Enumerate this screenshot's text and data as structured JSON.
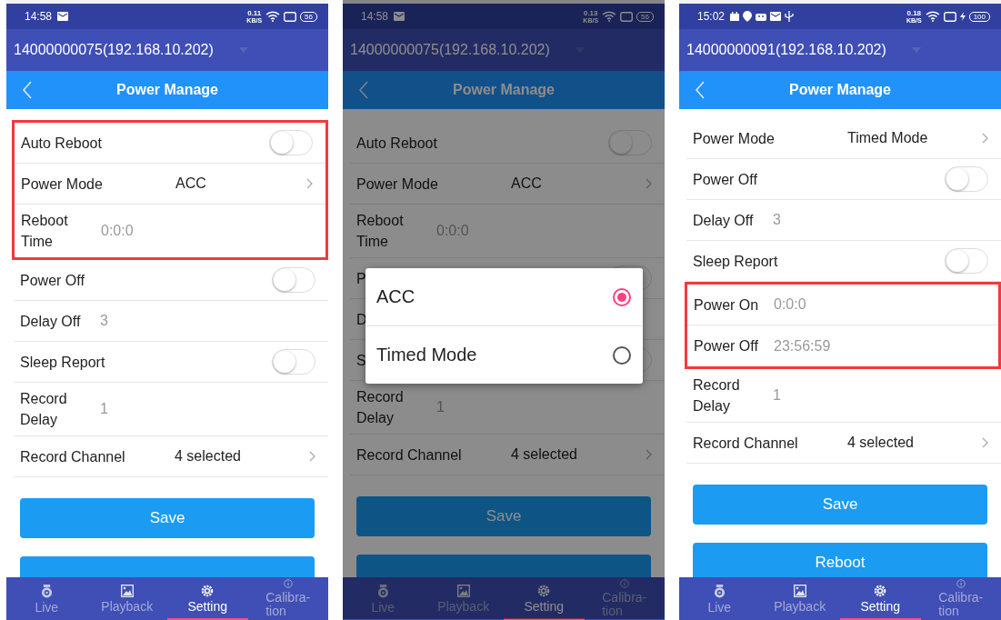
{
  "phones": [
    {
      "status": {
        "time": "14:58",
        "notifications": [
          {
            "kind": "mail"
          }
        ],
        "net_speed": "0.11",
        "net_unit": "KB/S",
        "battery": "56"
      },
      "device": "14000000075(192.168.10.202)",
      "title": "Power Manage",
      "at_top": true,
      "sections": [
        {
          "highlighted": true,
          "rows": [
            {
              "kind": "toggle",
              "label": "Auto Reboot",
              "on": false
            },
            {
              "kind": "select",
              "label": "Power Mode",
              "value": "ACC"
            },
            {
              "kind": "text",
              "label": "Reboot Time",
              "value": "0:0:0"
            }
          ]
        },
        {
          "highlighted": false,
          "rows": [
            {
              "kind": "toggle",
              "label": "Power Off",
              "on": false
            },
            {
              "kind": "text",
              "label": "Delay Off",
              "value": "3"
            },
            {
              "kind": "toggle",
              "label": "Sleep Report",
              "on": false
            },
            {
              "kind": "text",
              "label": "Record Delay",
              "value": "1"
            },
            {
              "kind": "select",
              "label": "Record Channel",
              "value": "4 selected"
            }
          ]
        }
      ],
      "buttons": [
        {
          "label": "Save"
        }
      ],
      "next_button_peek": true,
      "nav": [
        {
          "kind": "live",
          "label": "Live",
          "selected": false
        },
        {
          "kind": "playback",
          "label": "Playback",
          "selected": false
        },
        {
          "kind": "setting",
          "label": "Setting",
          "selected": true
        },
        {
          "kind": "calibration",
          "label": "Calibra-\ntion",
          "selected": false
        }
      ]
    },
    {
      "status": {
        "time": "14:58",
        "notifications": [
          {
            "kind": "mail"
          }
        ],
        "net_speed": "0.13",
        "net_unit": "KB/S",
        "battery": "56"
      },
      "device": "14000000075(192.168.10.202)",
      "title": "Power Manage",
      "at_top": true,
      "dimmed": true,
      "sections": [
        {
          "highlighted": false,
          "rows": [
            {
              "kind": "toggle",
              "label": "Auto Reboot",
              "on": false
            },
            {
              "kind": "select",
              "label": "Power Mode",
              "value": "ACC"
            },
            {
              "kind": "text",
              "label": "Reboot Time",
              "value": "0:0:0"
            },
            {
              "kind": "toggle",
              "label": "P",
              "on": false
            },
            {
              "kind": "text",
              "label": "D"
            },
            {
              "kind": "toggle",
              "label": "S",
              "on": false
            },
            {
              "kind": "text",
              "label": "Record Delay",
              "value": "1"
            },
            {
              "kind": "select",
              "label": "Record Channel",
              "value": "4 selected"
            }
          ]
        }
      ],
      "buttons": [
        {
          "label": "Save"
        }
      ],
      "next_button_peek": true,
      "dialog": {
        "options": [
          {
            "label": "ACC",
            "selected": true
          },
          {
            "label": "Timed Mode",
            "selected": false
          }
        ]
      },
      "nav": [
        {
          "kind": "live",
          "label": "Live",
          "selected": false
        },
        {
          "kind": "playback",
          "label": "Playback",
          "selected": false
        },
        {
          "kind": "setting",
          "label": "Setting",
          "selected": true
        },
        {
          "kind": "calibration",
          "label": "Calibra-\ntion",
          "selected": false
        }
      ]
    },
    {
      "status": {
        "time": "15:02",
        "notifications": [
          {
            "kind": "calendar"
          },
          {
            "kind": "location"
          },
          {
            "kind": "android"
          },
          {
            "kind": "mail"
          },
          {
            "kind": "usb"
          }
        ],
        "net_speed": "0.18",
        "net_unit": "KB/S",
        "charging": true,
        "battery": "100"
      },
      "device": "14000000091(192.168.10.202)",
      "title": "Power Manage",
      "at_top": false,
      "sections": [
        {
          "highlighted": false,
          "rows": [
            {
              "kind": "select",
              "label": "Power Mode",
              "value": "Timed Mode"
            },
            {
              "kind": "toggle",
              "label": "Power Off",
              "on": false
            },
            {
              "kind": "text",
              "label": "Delay Off",
              "value": "3"
            },
            {
              "kind": "toggle",
              "label": "Sleep Report",
              "on": false
            }
          ]
        },
        {
          "highlighted": true,
          "rows": [
            {
              "kind": "text",
              "label": "Power On",
              "value": "0:0:0"
            },
            {
              "kind": "text",
              "label": "Power Off",
              "value": "23:56:59"
            }
          ]
        },
        {
          "highlighted": false,
          "rows": [
            {
              "kind": "text",
              "label": "Record Delay",
              "value": "1"
            },
            {
              "kind": "select",
              "label": "Record Channel",
              "value": "4 selected"
            }
          ]
        }
      ],
      "buttons": [
        {
          "label": "Save"
        },
        {
          "label": "Reboot"
        }
      ],
      "nav": [
        {
          "kind": "live",
          "label": "Live",
          "selected": false
        },
        {
          "kind": "playback",
          "label": "Playback",
          "selected": false
        },
        {
          "kind": "setting",
          "label": "Setting",
          "selected": true
        },
        {
          "kind": "calibration",
          "label": "Calibra-\ntion",
          "selected": false
        }
      ]
    }
  ]
}
